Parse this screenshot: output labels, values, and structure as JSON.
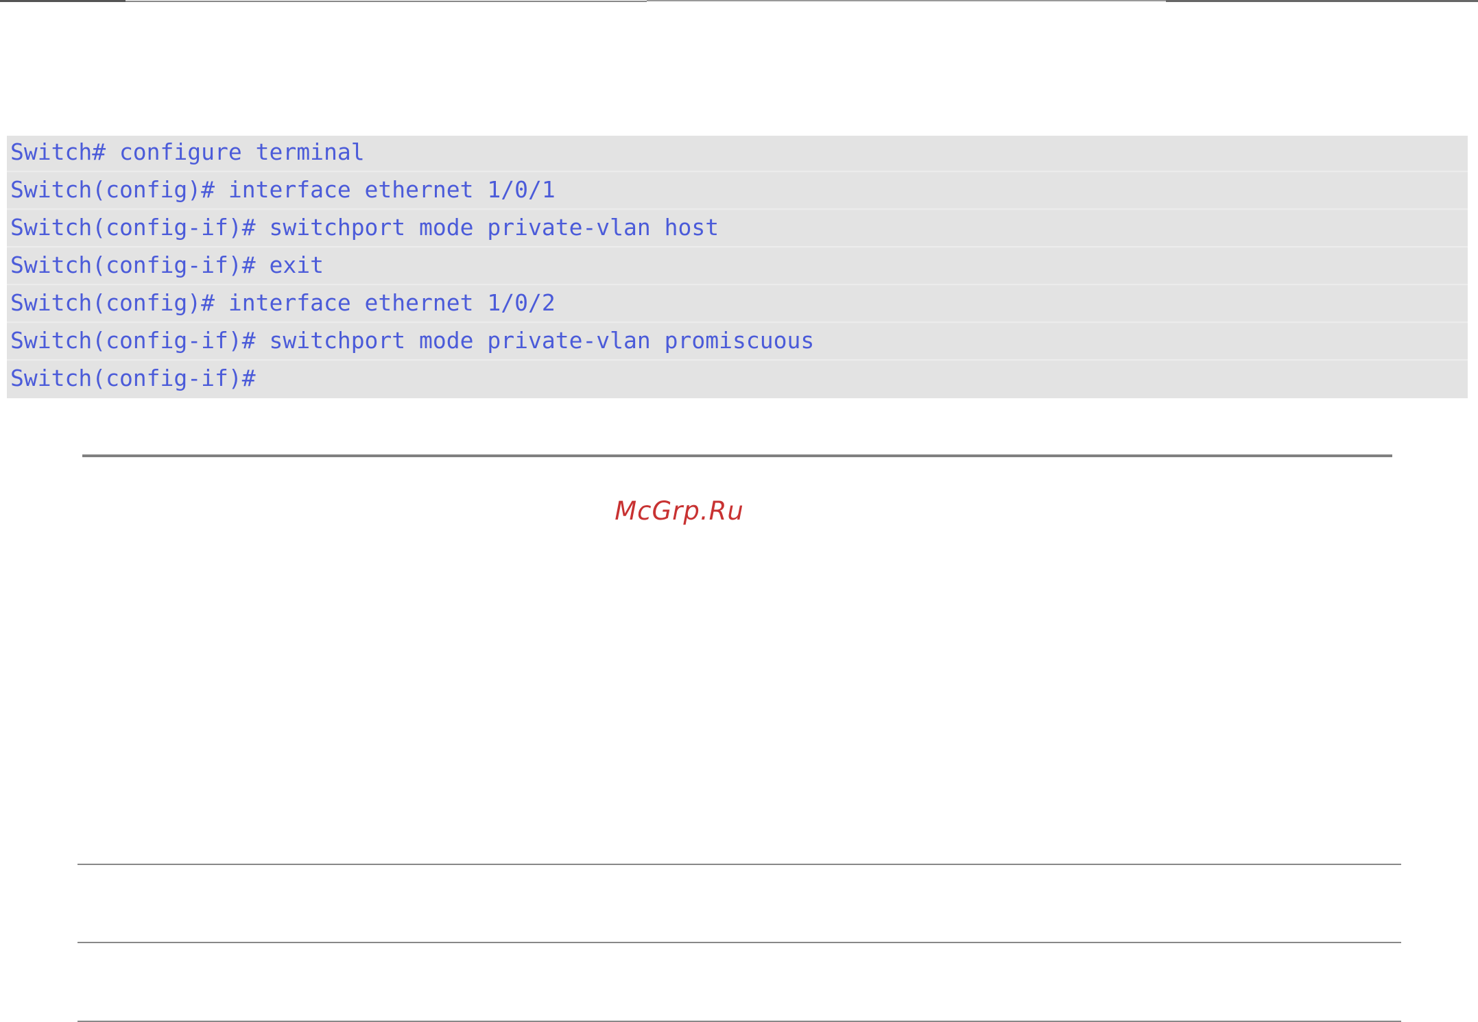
{
  "code": {
    "lines": [
      "Switch# configure terminal",
      "Switch(config)# interface ethernet 1/0/1",
      "Switch(config-if)# switchport mode private-vlan host",
      "Switch(config-if)# exit",
      "Switch(config)# interface ethernet 1/0/2",
      "Switch(config-if)# switchport mode private-vlan promiscuous",
      "Switch(config-if)#"
    ],
    "text_color": "#4b5bd9",
    "background_color": "#e4e4e4"
  },
  "watermark": {
    "text": "McGrp.Ru",
    "color": "#c83232"
  }
}
